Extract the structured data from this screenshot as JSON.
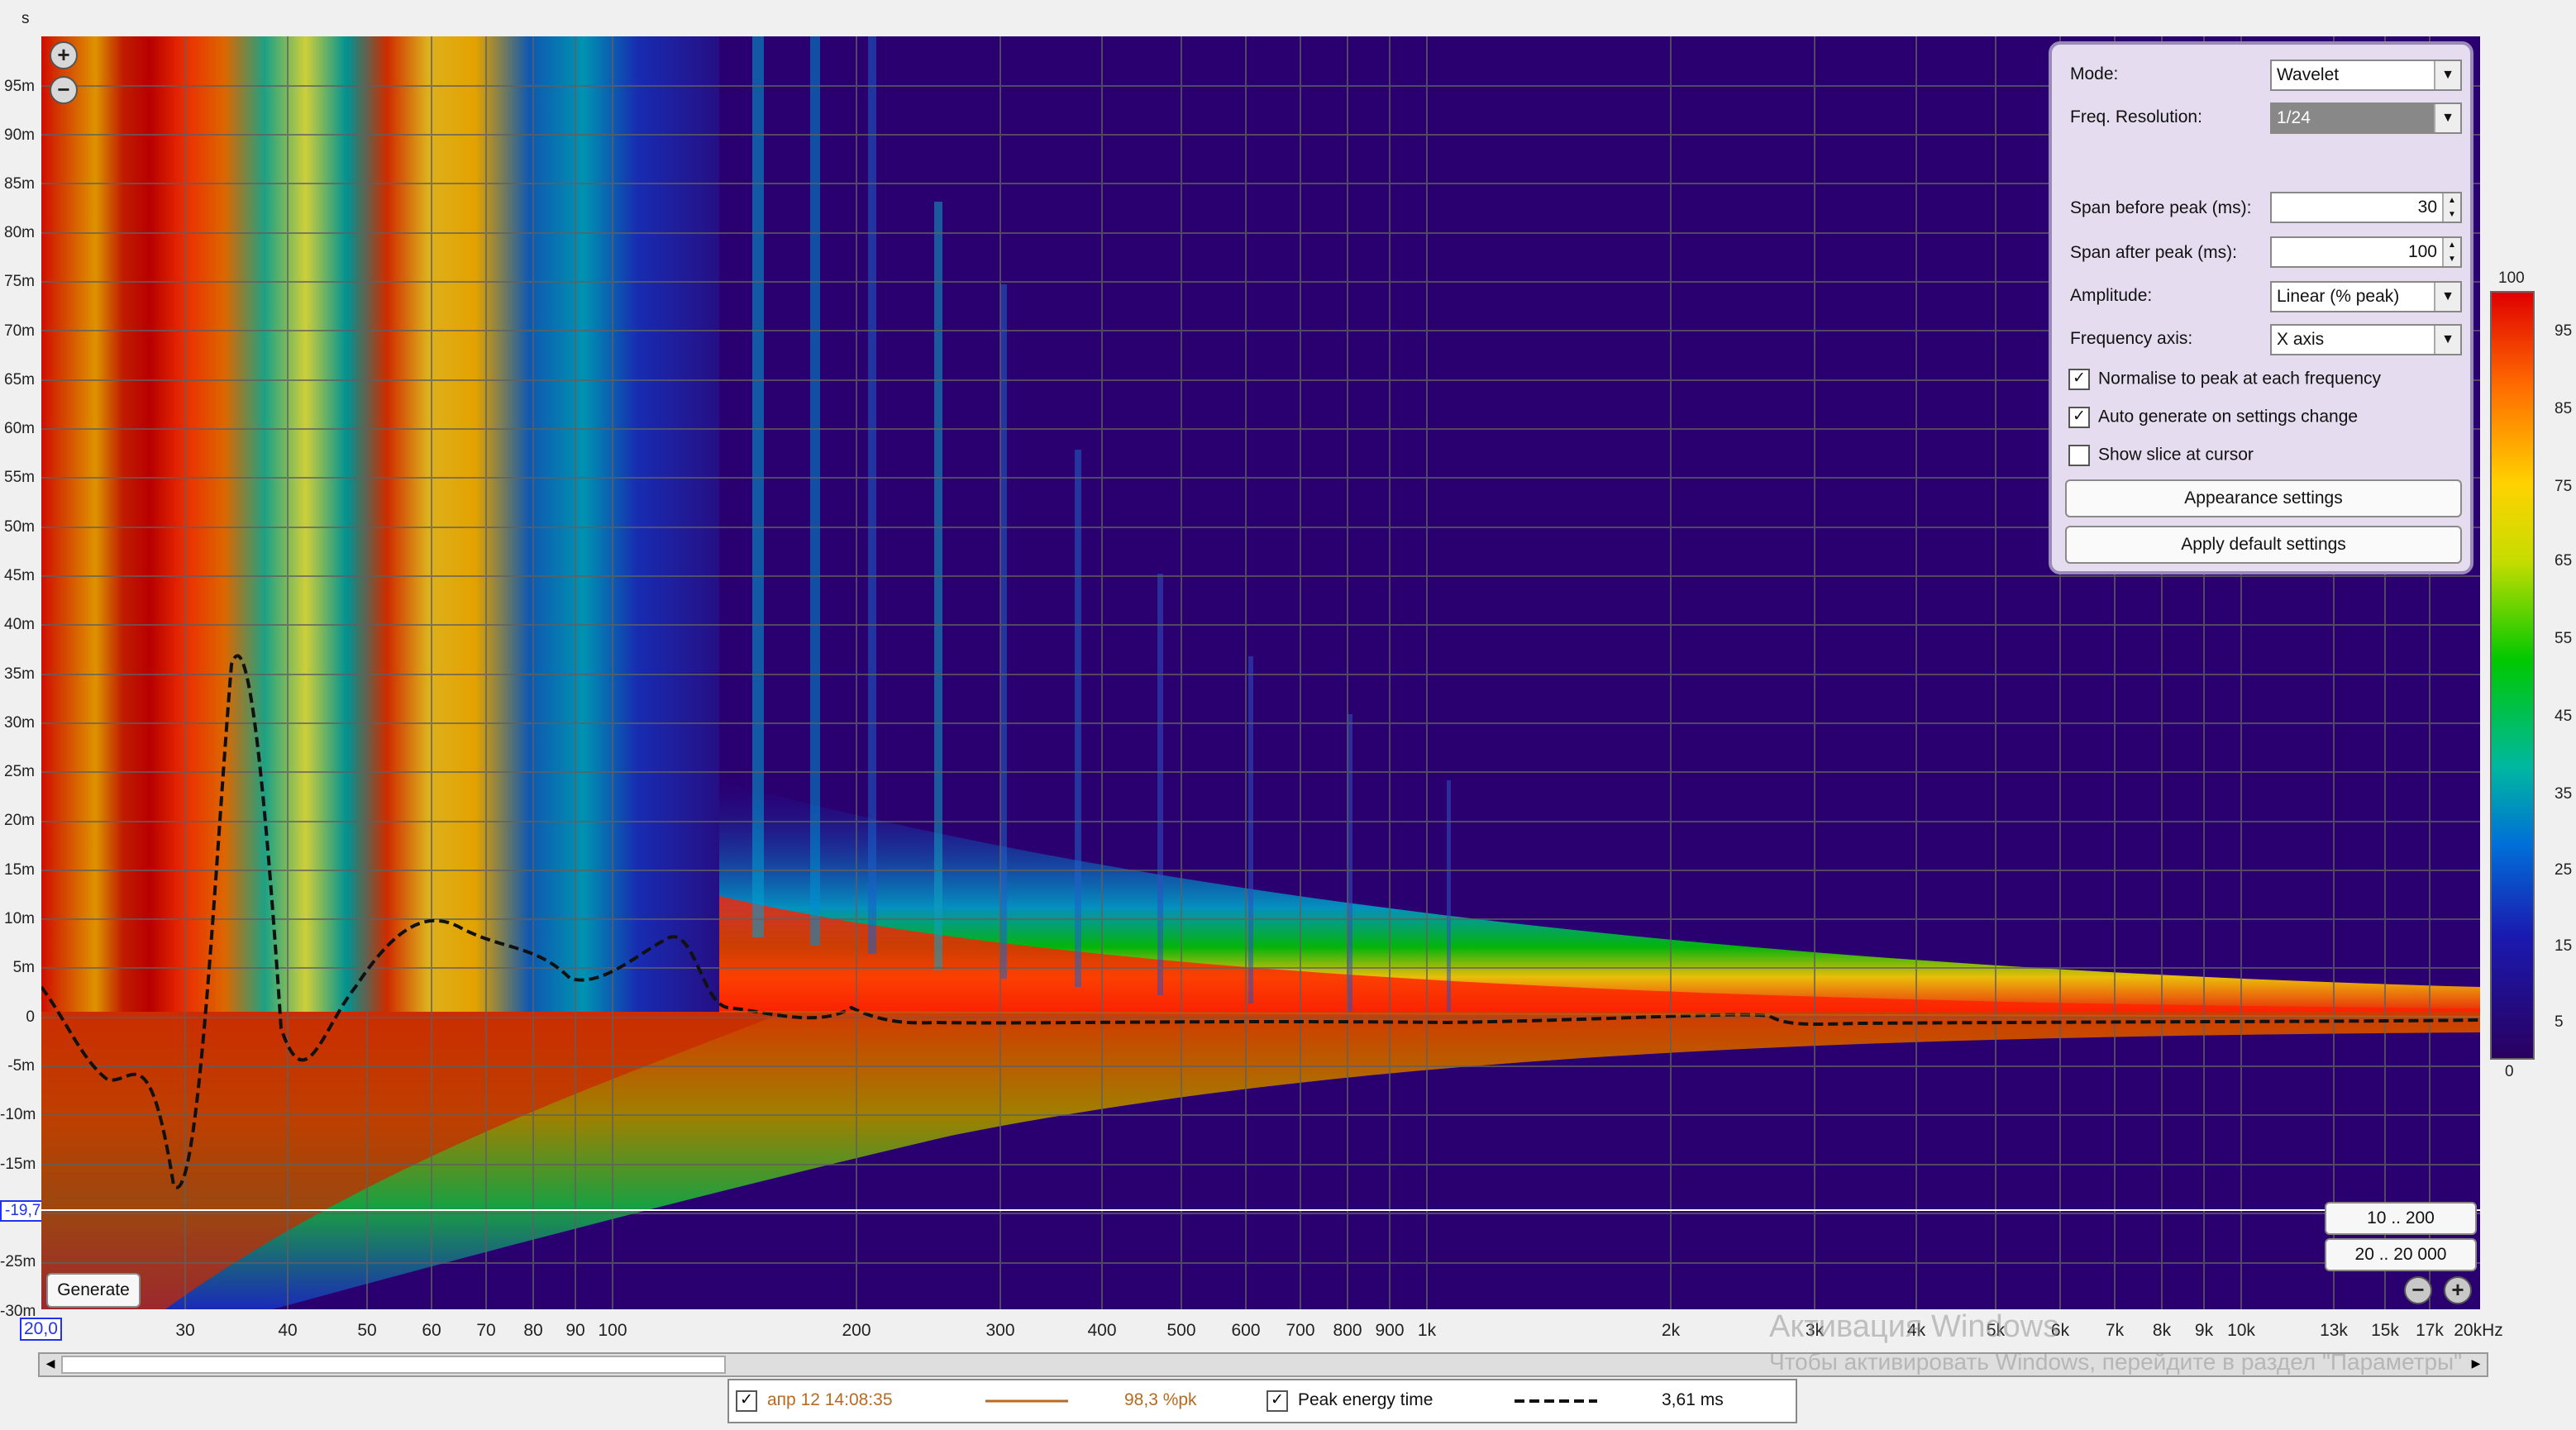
{
  "axes": {
    "y_unit": "s",
    "y_ticks": [
      "95m",
      "90m",
      "85m",
      "80m",
      "75m",
      "70m",
      "65m",
      "60m",
      "55m",
      "50m",
      "45m",
      "40m",
      "35m",
      "30m",
      "25m",
      "20m",
      "15m",
      "10m",
      "5m",
      "0",
      "-5m",
      "-10m",
      "-15m",
      "-20m",
      "-25m",
      "-30m"
    ],
    "x_ticks": [
      "30",
      "40",
      "50",
      "60",
      "70",
      "80",
      "90",
      "100",
      "200",
      "300",
      "400",
      "500",
      "600",
      "700",
      "800",
      "900",
      "1k",
      "2k",
      "3k",
      "4k",
      "5k",
      "6k",
      "7k",
      "8k",
      "9k",
      "10k",
      "13k",
      "15k",
      "17k",
      "20kHz"
    ],
    "x_start": "20,0",
    "cursor_time": "-19,7m"
  },
  "buttons": {
    "generate": "Generate",
    "range_low": "10 .. 200",
    "range_full": "20 .. 20 000"
  },
  "settings": {
    "mode_label": "Mode:",
    "mode_value": "Wavelet",
    "freq_res_label": "Freq. Resolution:",
    "freq_res_value": "1/24",
    "span_before_label": "Span before peak (ms):",
    "span_before_value": "30",
    "span_after_label": "Span after peak (ms):",
    "span_after_value": "100",
    "amplitude_label": "Amplitude:",
    "amplitude_value": "Linear (% peak)",
    "freq_axis_label": "Frequency axis:",
    "freq_axis_value": "X axis",
    "normalise_label": "Normalise to peak at each frequency",
    "normalise_checked": true,
    "autogen_label": "Auto generate on settings change",
    "autogen_checked": true,
    "slice_label": "Show slice at cursor",
    "slice_checked": false,
    "appearance_btn": "Appearance settings",
    "defaults_btn": "Apply default settings"
  },
  "colorscale": {
    "top": "100",
    "bottom": "0",
    "ticks": [
      "95",
      "85",
      "75",
      "65",
      "55",
      "45",
      "35",
      "25",
      "15",
      "5"
    ]
  },
  "legend": {
    "trace1_name": "апр 12 14:08:35",
    "trace1_value": "98,3 %pk",
    "trace1_color": "#b86a20",
    "trace2_name": "Peak energy time",
    "trace2_value": "3,61 ms"
  },
  "watermark": {
    "line1": "Активация Windows",
    "line2": "Чтобы активировать Windows, перейдите в раздел \"Параметры\""
  }
}
